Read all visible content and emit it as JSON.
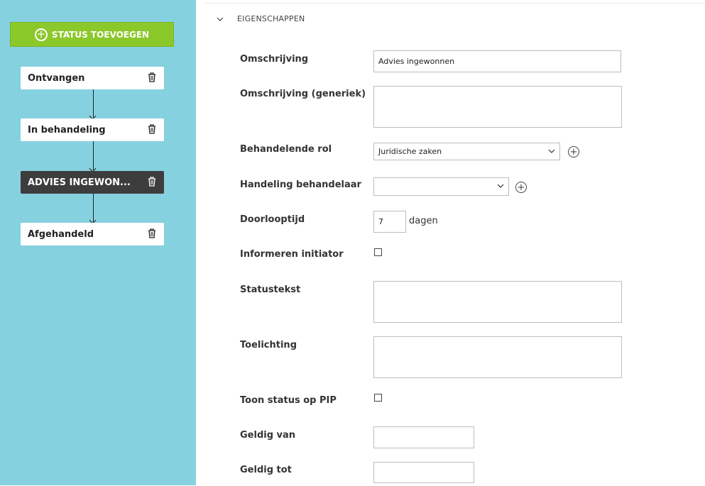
{
  "sidebar": {
    "add_button_label": "STATUS TOEVOEGEN",
    "statuses": [
      {
        "label": "Ontvangen"
      },
      {
        "label": "In behandeling"
      },
      {
        "label": "ADVIES INGEWON..."
      },
      {
        "label": "Afgehandeld"
      }
    ]
  },
  "section": {
    "title": "EIGENSCHAPPEN"
  },
  "form": {
    "omschrijving": {
      "label": "Omschrijving",
      "value": "Advies ingewonnen"
    },
    "omschrijving_generiek": {
      "label": "Omschrijving (generiek)",
      "value": ""
    },
    "behandelende_rol": {
      "label": "Behandelende rol",
      "value": "Juridische zaken"
    },
    "handeling_behandelaar": {
      "label": "Handeling behandelaar",
      "value": ""
    },
    "doorlooptijd": {
      "label": "Doorlooptijd",
      "value": "7",
      "unit": "dagen"
    },
    "informeren_initiator": {
      "label": "Informeren initiator"
    },
    "statustekst": {
      "label": "Statustekst",
      "value": ""
    },
    "toelichting": {
      "label": "Toelichting",
      "value": ""
    },
    "toon_status_op_pip": {
      "label": "Toon status op PIP"
    },
    "geldig_van": {
      "label": "Geldig van",
      "value": ""
    },
    "geldig_tot": {
      "label": "Geldig tot",
      "value": ""
    }
  },
  "colors": {
    "sidebar_bg": "#86d1e0",
    "add_button_bg": "#8bc82a",
    "active_status_bg": "#3d3d3d"
  }
}
